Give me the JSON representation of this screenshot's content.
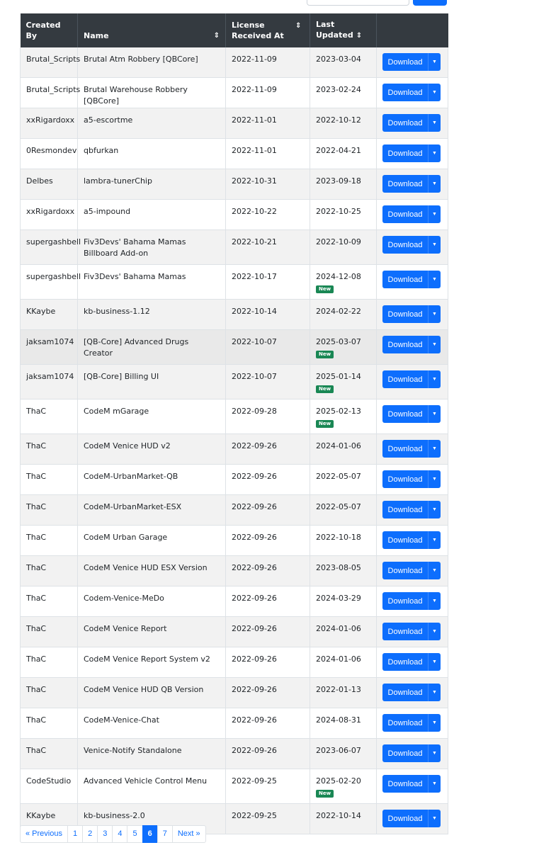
{
  "table": {
    "headers": {
      "created_by": "Created By",
      "name": "Name",
      "license_received": "License Received At",
      "last_updated": "Last Updated"
    },
    "sort_icon": "sort-icon",
    "download_label": "Download",
    "new_badge": "New",
    "rows": [
      {
        "created_by": "Brutal_Scripts",
        "name": "Brutal Atm Robbery [QBCore]",
        "license": "2022-11-09",
        "updated": "2023-03-04",
        "badge": ""
      },
      {
        "created_by": "Brutal_Scripts",
        "name": "Brutal Warehouse Robbery [QBCore]",
        "license": "2022-11-09",
        "updated": "2023-02-24",
        "badge": ""
      },
      {
        "created_by": "xxRigardoxx",
        "name": "a5-escortme",
        "license": "2022-11-01",
        "updated": "2022-10-12",
        "badge": ""
      },
      {
        "created_by": "0Resmondev",
        "name": "qbfurkan",
        "license": "2022-11-01",
        "updated": "2022-04-21",
        "badge": ""
      },
      {
        "created_by": "Delbes",
        "name": "lambra-tunerChip",
        "license": "2022-10-31",
        "updated": "2023-09-18",
        "badge": ""
      },
      {
        "created_by": "xxRigardoxx",
        "name": "a5-impound",
        "license": "2022-10-22",
        "updated": "2022-10-25",
        "badge": ""
      },
      {
        "created_by": "supergashbell",
        "name": "Fiv3Devs' Bahama Mamas Billboard Add-on",
        "license": "2022-10-21",
        "updated": "2022-10-09",
        "badge": ""
      },
      {
        "created_by": "supergashbell",
        "name": "Fiv3Devs' Bahama Mamas",
        "license": "2022-10-17",
        "updated": "2024-12-08",
        "badge": "New"
      },
      {
        "created_by": "KKaybe",
        "name": "kb-business-1.12",
        "license": "2022-10-14",
        "updated": "2024-02-22",
        "badge": ""
      },
      {
        "created_by": "jaksam1074",
        "name": "[QB-Core] Advanced Drugs Creator",
        "license": "2022-10-07",
        "updated": "2025-03-07",
        "badge": "New"
      },
      {
        "created_by": "jaksam1074",
        "name": "[QB-Core] Billing UI",
        "license": "2022-10-07",
        "updated": "2025-01-14",
        "badge": "New"
      },
      {
        "created_by": "ThaC",
        "name": "CodeM mGarage",
        "license": "2022-09-28",
        "updated": "2025-02-13",
        "badge": "New"
      },
      {
        "created_by": "ThaC",
        "name": "CodeM Venice HUD v2",
        "license": "2022-09-26",
        "updated": "2024-01-06",
        "badge": ""
      },
      {
        "created_by": "ThaC",
        "name": "CodeM-UrbanMarket-QB",
        "license": "2022-09-26",
        "updated": "2022-05-07",
        "badge": ""
      },
      {
        "created_by": "ThaC",
        "name": "CodeM-UrbanMarket-ESX",
        "license": "2022-09-26",
        "updated": "2022-05-07",
        "badge": ""
      },
      {
        "created_by": "ThaC",
        "name": "CodeM Urban Garage",
        "license": "2022-09-26",
        "updated": "2022-10-18",
        "badge": ""
      },
      {
        "created_by": "ThaC",
        "name": "CodeM Venice HUD ESX Version",
        "license": "2022-09-26",
        "updated": "2023-08-05",
        "badge": ""
      },
      {
        "created_by": "ThaC",
        "name": "Codem-Venice-MeDo",
        "license": "2022-09-26",
        "updated": "2024-03-29",
        "badge": ""
      },
      {
        "created_by": "ThaC",
        "name": "CodeM Venice Report",
        "license": "2022-09-26",
        "updated": "2024-01-06",
        "badge": ""
      },
      {
        "created_by": "ThaC",
        "name": "CodeM Venice Report System v2",
        "license": "2022-09-26",
        "updated": "2024-01-06",
        "badge": ""
      },
      {
        "created_by": "ThaC",
        "name": "CodeM Venice HUD QB Version",
        "license": "2022-09-26",
        "updated": "2022-01-13",
        "badge": ""
      },
      {
        "created_by": "ThaC",
        "name": "CodeM-Venice-Chat",
        "license": "2022-09-26",
        "updated": "2024-08-31",
        "badge": ""
      },
      {
        "created_by": "ThaC",
        "name": "Venice-Notify Standalone",
        "license": "2022-09-26",
        "updated": "2023-06-07",
        "badge": ""
      },
      {
        "created_by": "CodeStudio",
        "name": "Advanced Vehicle Control Menu",
        "license": "2022-09-25",
        "updated": "2025-02-20",
        "badge": "New"
      },
      {
        "created_by": "KKaybe",
        "name": "kb-business-2.0",
        "license": "2022-09-25",
        "updated": "2022-10-14",
        "badge": ""
      }
    ]
  },
  "pagination": {
    "previous": "« Previous",
    "pages": [
      "1",
      "2",
      "3",
      "4",
      "5",
      "6",
      "7"
    ],
    "active": "6",
    "next": "Next »"
  },
  "colors": {
    "header_bg": "#343a40",
    "primary": "#0d6efd",
    "badge_new": "#198754"
  }
}
